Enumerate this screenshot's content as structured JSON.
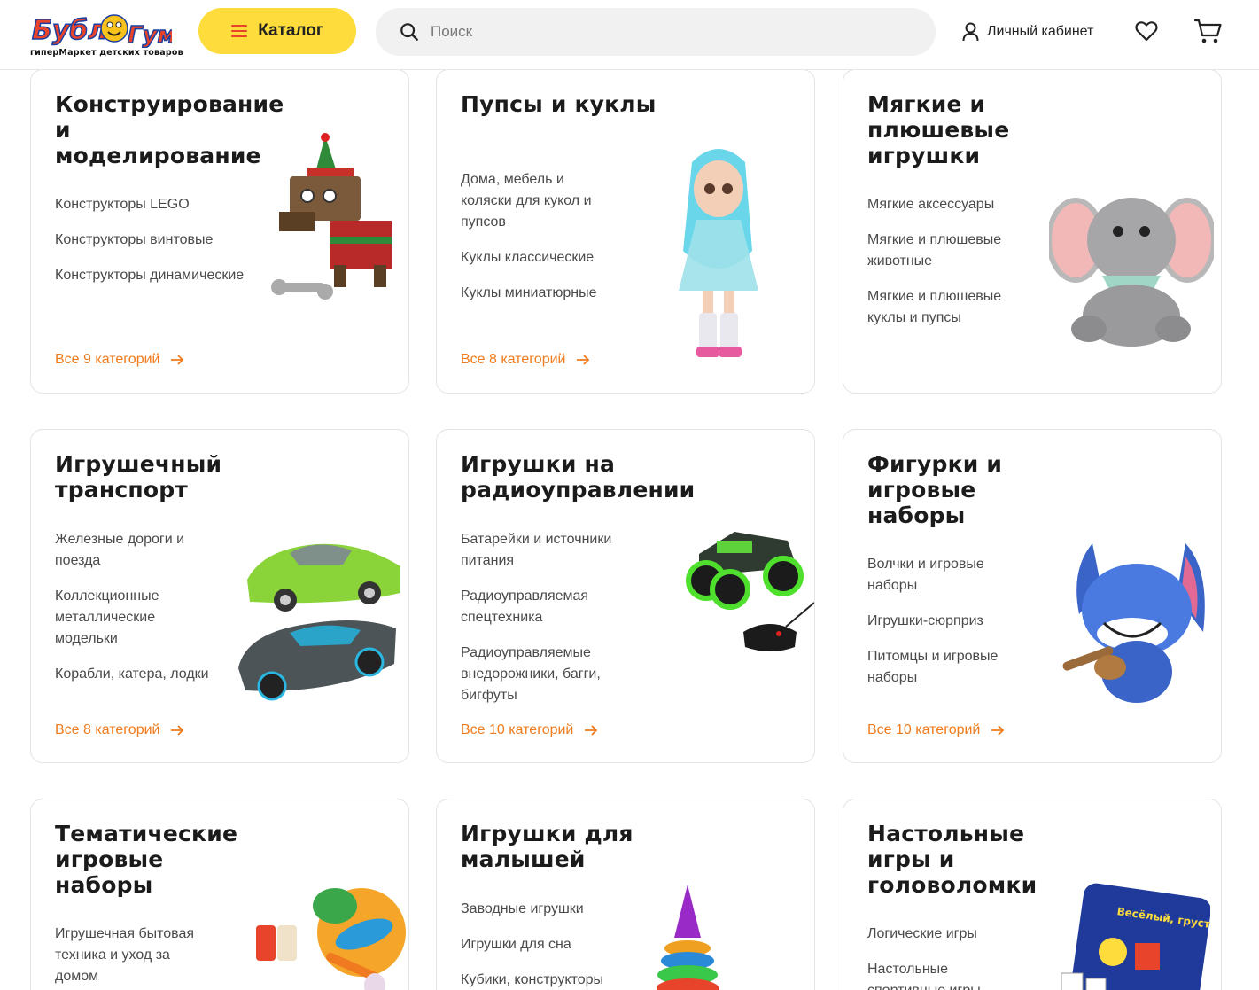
{
  "header": {
    "logo_text": "БубльГум",
    "logo_tagline": "гиперМаркет детских товаров",
    "catalog_label": "Каталог",
    "search_placeholder": "Поиск",
    "account_label": "Личный кабинет"
  },
  "colors": {
    "accent_yellow": "#fddc3c",
    "link_orange": "#f07b1c",
    "logo_red": "#e8432b"
  },
  "cards": [
    {
      "title": "Конструирование и моделирование",
      "items": [
        "Конструкторы LEGO",
        "Конструкторы винтовые",
        "Конструкторы динамические"
      ],
      "all_link": "Все 9 категорий",
      "image": "lego-dog-figure"
    },
    {
      "title": "Пупсы и куклы",
      "items": [
        "Дома, мебель и коляски для кукол и пупсов",
        "Куклы классические",
        "Куклы миниатюрные"
      ],
      "all_link": "Все 8 категорий",
      "image": "doll-blue-hair"
    },
    {
      "title": "Мягкие и плюшевые игрушки",
      "items": [
        "Мягкие аксессуары",
        "Мягкие и плюшевые животные",
        "Мягкие и плюшевые куклы и пупсы"
      ],
      "all_link": "",
      "image": "plush-elephant"
    },
    {
      "title": "Игрушечный транспорт",
      "items": [
        "Железные дороги и поезда",
        "Коллекционные металлические модельки",
        "Корабли, катера, лодки"
      ],
      "all_link": "Все 8 категорий",
      "image": "toy-cars"
    },
    {
      "title": "Игрушки на радиоуправлении",
      "items": [
        "Батарейки и источники питания",
        "Радиоуправляемая спецтехника",
        "Радиоуправляемые внедорожники, багги, бигфуты"
      ],
      "all_link": "Все 10 категорий",
      "image": "rc-monster-truck"
    },
    {
      "title": "Фигурки и игровые наборы",
      "items": [
        "Волчки и игровые наборы",
        "Игрушки-сюрприз",
        "Питомцы и игровые наборы"
      ],
      "all_link": "Все 10 категорий",
      "image": "stitch-figure"
    },
    {
      "title": "Тематические игровые наборы",
      "items": [
        "Игрушечная бытовая техника и уход за домом"
      ],
      "all_link": "",
      "image": "toy-food-set"
    },
    {
      "title": "Игрушки для малышей",
      "items": [
        "Заводные игрушки",
        "Игрушки для сна",
        "Кубики, конструкторы"
      ],
      "all_link": "",
      "image": "stacking-pyramid"
    },
    {
      "title": "Настольные игры и головоломки",
      "items": [
        "Логические игры",
        "Настольные спортивные игры"
      ],
      "all_link": "",
      "image": "board-game-box"
    }
  ],
  "board_game_box_text": "Весёлый, грустный, злой"
}
